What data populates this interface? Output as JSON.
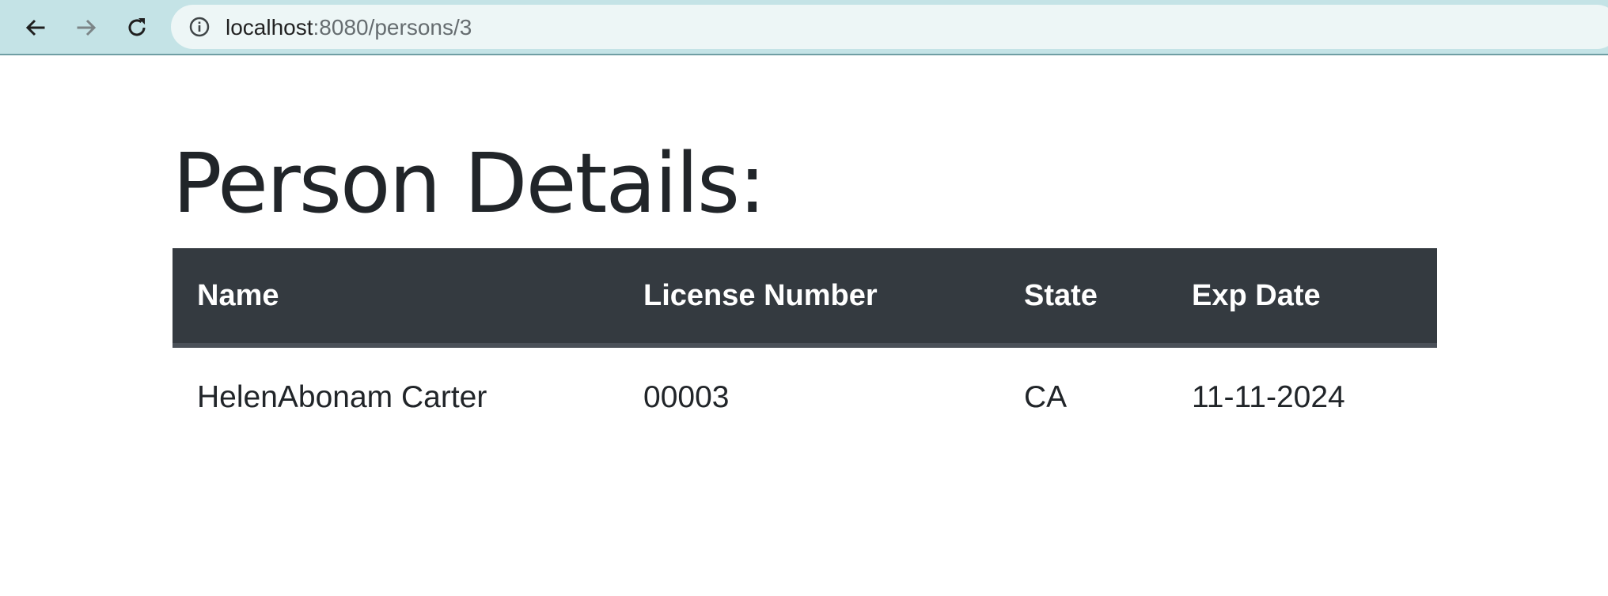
{
  "browser": {
    "back_icon": "arrow-left-icon",
    "forward_icon": "arrow-right-icon",
    "reload_icon": "reload-icon",
    "site_info_icon": "info-icon",
    "url_host": "localhost",
    "url_path": ":8080/persons/3"
  },
  "page": {
    "title": "Person Details:"
  },
  "table": {
    "headers": {
      "name": "Name",
      "license_number": "License Number",
      "state": "State",
      "exp_date": "Exp Date"
    },
    "rows": [
      {
        "name": "HelenAbonam Carter",
        "license_number": "00003",
        "state": "CA",
        "exp_date": "11-11-2024"
      }
    ]
  },
  "colors": {
    "toolbar_background": "#c4e3e6",
    "address_bar_background": "#edf6f6",
    "table_header_background": "#343a40",
    "table_header_text": "#ffffff",
    "body_text": "#212529"
  }
}
